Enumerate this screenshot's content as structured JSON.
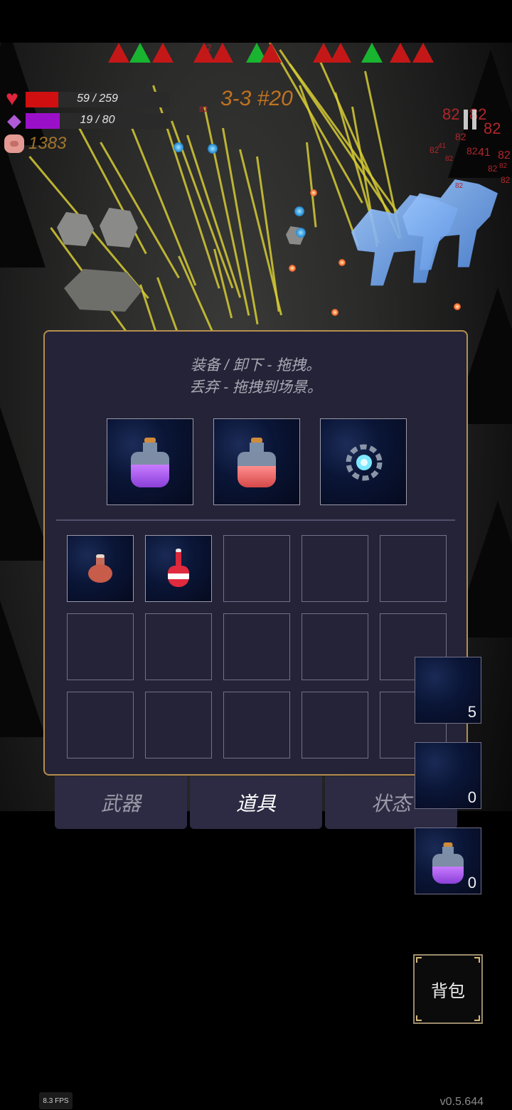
{
  "hud": {
    "hp_text": "59 / 259",
    "hp_fraction": 0.228,
    "mp_text": "19 / 80",
    "mp_fraction": 0.2375,
    "coins": "1383",
    "wave_label": "3-3 #20",
    "threat_indicators": [
      "red",
      "green",
      "red",
      "red",
      "red",
      "green",
      "red",
      "red",
      "red",
      "green",
      "red",
      "red"
    ]
  },
  "scene": {
    "damage_numbers": [
      "82",
      "82",
      "82",
      "82",
      "82",
      "82",
      "41",
      "82",
      "82",
      "82",
      "41",
      "82",
      "82",
      "82",
      "82",
      "82"
    ]
  },
  "inventory": {
    "hint_line1": "装备 / 卸下 - 拖拽。",
    "hint_line2": "丢弃 - 拖拽到场景。",
    "equipped": [
      {
        "item": "purple-potion-icon"
      },
      {
        "item": "red-potion-icon"
      },
      {
        "item": "gear-orb-icon"
      }
    ],
    "bag": [
      {
        "item": "small-red-flask-icon"
      },
      {
        "item": "red-bottle-icon"
      },
      {
        "item": ""
      },
      {
        "item": ""
      },
      {
        "item": ""
      },
      {
        "item": ""
      },
      {
        "item": ""
      },
      {
        "item": ""
      },
      {
        "item": ""
      },
      {
        "item": ""
      },
      {
        "item": ""
      },
      {
        "item": ""
      },
      {
        "item": ""
      },
      {
        "item": ""
      },
      {
        "item": ""
      }
    ]
  },
  "tabs": [
    {
      "label": "武器",
      "active": false
    },
    {
      "label": "道具",
      "active": true
    },
    {
      "label": "状态",
      "active": false
    }
  ],
  "quickbar": [
    {
      "count": "5"
    },
    {
      "count": "0"
    },
    {
      "count": "0",
      "item": "purple-potion-icon"
    }
  ],
  "bag_button": "背包",
  "fps": "8.3 FPS",
  "version": "v0.5.644",
  "colors": {
    "panel_bg": "#242338",
    "panel_border": "#b58e4e",
    "hp": "#d01010",
    "mp": "#9a10c8",
    "wave": "#d07a1f",
    "coins": "#c28b2d"
  }
}
